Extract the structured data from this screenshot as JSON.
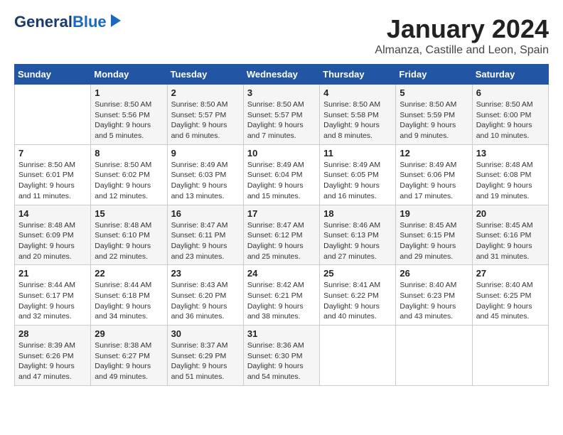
{
  "logo": {
    "line1": "General",
    "line2": "Blue"
  },
  "header": {
    "month": "January 2024",
    "location": "Almanza, Castille and Leon, Spain"
  },
  "days_of_week": [
    "Sunday",
    "Monday",
    "Tuesday",
    "Wednesday",
    "Thursday",
    "Friday",
    "Saturday"
  ],
  "weeks": [
    [
      {
        "day": "",
        "sunrise": "",
        "sunset": "",
        "daylight": ""
      },
      {
        "day": "1",
        "sunrise": "Sunrise: 8:50 AM",
        "sunset": "Sunset: 5:56 PM",
        "daylight": "Daylight: 9 hours and 5 minutes."
      },
      {
        "day": "2",
        "sunrise": "Sunrise: 8:50 AM",
        "sunset": "Sunset: 5:57 PM",
        "daylight": "Daylight: 9 hours and 6 minutes."
      },
      {
        "day": "3",
        "sunrise": "Sunrise: 8:50 AM",
        "sunset": "Sunset: 5:57 PM",
        "daylight": "Daylight: 9 hours and 7 minutes."
      },
      {
        "day": "4",
        "sunrise": "Sunrise: 8:50 AM",
        "sunset": "Sunset: 5:58 PM",
        "daylight": "Daylight: 9 hours and 8 minutes."
      },
      {
        "day": "5",
        "sunrise": "Sunrise: 8:50 AM",
        "sunset": "Sunset: 5:59 PM",
        "daylight": "Daylight: 9 hours and 9 minutes."
      },
      {
        "day": "6",
        "sunrise": "Sunrise: 8:50 AM",
        "sunset": "Sunset: 6:00 PM",
        "daylight": "Daylight: 9 hours and 10 minutes."
      }
    ],
    [
      {
        "day": "7",
        "sunrise": "Sunrise: 8:50 AM",
        "sunset": "Sunset: 6:01 PM",
        "daylight": "Daylight: 9 hours and 11 minutes."
      },
      {
        "day": "8",
        "sunrise": "Sunrise: 8:50 AM",
        "sunset": "Sunset: 6:02 PM",
        "daylight": "Daylight: 9 hours and 12 minutes."
      },
      {
        "day": "9",
        "sunrise": "Sunrise: 8:49 AM",
        "sunset": "Sunset: 6:03 PM",
        "daylight": "Daylight: 9 hours and 13 minutes."
      },
      {
        "day": "10",
        "sunrise": "Sunrise: 8:49 AM",
        "sunset": "Sunset: 6:04 PM",
        "daylight": "Daylight: 9 hours and 15 minutes."
      },
      {
        "day": "11",
        "sunrise": "Sunrise: 8:49 AM",
        "sunset": "Sunset: 6:05 PM",
        "daylight": "Daylight: 9 hours and 16 minutes."
      },
      {
        "day": "12",
        "sunrise": "Sunrise: 8:49 AM",
        "sunset": "Sunset: 6:06 PM",
        "daylight": "Daylight: 9 hours and 17 minutes."
      },
      {
        "day": "13",
        "sunrise": "Sunrise: 8:48 AM",
        "sunset": "Sunset: 6:08 PM",
        "daylight": "Daylight: 9 hours and 19 minutes."
      }
    ],
    [
      {
        "day": "14",
        "sunrise": "Sunrise: 8:48 AM",
        "sunset": "Sunset: 6:09 PM",
        "daylight": "Daylight: 9 hours and 20 minutes."
      },
      {
        "day": "15",
        "sunrise": "Sunrise: 8:48 AM",
        "sunset": "Sunset: 6:10 PM",
        "daylight": "Daylight: 9 hours and 22 minutes."
      },
      {
        "day": "16",
        "sunrise": "Sunrise: 8:47 AM",
        "sunset": "Sunset: 6:11 PM",
        "daylight": "Daylight: 9 hours and 23 minutes."
      },
      {
        "day": "17",
        "sunrise": "Sunrise: 8:47 AM",
        "sunset": "Sunset: 6:12 PM",
        "daylight": "Daylight: 9 hours and 25 minutes."
      },
      {
        "day": "18",
        "sunrise": "Sunrise: 8:46 AM",
        "sunset": "Sunset: 6:13 PM",
        "daylight": "Daylight: 9 hours and 27 minutes."
      },
      {
        "day": "19",
        "sunrise": "Sunrise: 8:45 AM",
        "sunset": "Sunset: 6:15 PM",
        "daylight": "Daylight: 9 hours and 29 minutes."
      },
      {
        "day": "20",
        "sunrise": "Sunrise: 8:45 AM",
        "sunset": "Sunset: 6:16 PM",
        "daylight": "Daylight: 9 hours and 31 minutes."
      }
    ],
    [
      {
        "day": "21",
        "sunrise": "Sunrise: 8:44 AM",
        "sunset": "Sunset: 6:17 PM",
        "daylight": "Daylight: 9 hours and 32 minutes."
      },
      {
        "day": "22",
        "sunrise": "Sunrise: 8:44 AM",
        "sunset": "Sunset: 6:18 PM",
        "daylight": "Daylight: 9 hours and 34 minutes."
      },
      {
        "day": "23",
        "sunrise": "Sunrise: 8:43 AM",
        "sunset": "Sunset: 6:20 PM",
        "daylight": "Daylight: 9 hours and 36 minutes."
      },
      {
        "day": "24",
        "sunrise": "Sunrise: 8:42 AM",
        "sunset": "Sunset: 6:21 PM",
        "daylight": "Daylight: 9 hours and 38 minutes."
      },
      {
        "day": "25",
        "sunrise": "Sunrise: 8:41 AM",
        "sunset": "Sunset: 6:22 PM",
        "daylight": "Daylight: 9 hours and 40 minutes."
      },
      {
        "day": "26",
        "sunrise": "Sunrise: 8:40 AM",
        "sunset": "Sunset: 6:23 PM",
        "daylight": "Daylight: 9 hours and 43 minutes."
      },
      {
        "day": "27",
        "sunrise": "Sunrise: 8:40 AM",
        "sunset": "Sunset: 6:25 PM",
        "daylight": "Daylight: 9 hours and 45 minutes."
      }
    ],
    [
      {
        "day": "28",
        "sunrise": "Sunrise: 8:39 AM",
        "sunset": "Sunset: 6:26 PM",
        "daylight": "Daylight: 9 hours and 47 minutes."
      },
      {
        "day": "29",
        "sunrise": "Sunrise: 8:38 AM",
        "sunset": "Sunset: 6:27 PM",
        "daylight": "Daylight: 9 hours and 49 minutes."
      },
      {
        "day": "30",
        "sunrise": "Sunrise: 8:37 AM",
        "sunset": "Sunset: 6:29 PM",
        "daylight": "Daylight: 9 hours and 51 minutes."
      },
      {
        "day": "31",
        "sunrise": "Sunrise: 8:36 AM",
        "sunset": "Sunset: 6:30 PM",
        "daylight": "Daylight: 9 hours and 54 minutes."
      },
      {
        "day": "",
        "sunrise": "",
        "sunset": "",
        "daylight": ""
      },
      {
        "day": "",
        "sunrise": "",
        "sunset": "",
        "daylight": ""
      },
      {
        "day": "",
        "sunrise": "",
        "sunset": "",
        "daylight": ""
      }
    ]
  ]
}
